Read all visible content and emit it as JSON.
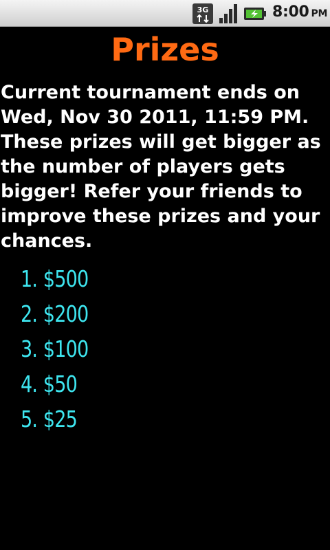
{
  "status_bar": {
    "network_icon": "3g-data-icon",
    "signal_icon": "signal-strength-icon",
    "battery_icon": "battery-charging-icon",
    "time": "8:00",
    "ampm": "PM"
  },
  "page": {
    "title": "Prizes",
    "description": "Current tournament ends on Wed, Nov 30 2011, 11:59 PM. These prizes will get bigger as the number of players gets bigger! Refer your friends to improve these prizes and your chances."
  },
  "prizes": [
    {
      "rank": "1.",
      "amount": "$500"
    },
    {
      "rank": "2.",
      "amount": "$200"
    },
    {
      "rank": "3.",
      "amount": "$100"
    },
    {
      "rank": "4.",
      "amount": "$50"
    },
    {
      "rank": "5.",
      "amount": "$25"
    }
  ],
  "colors": {
    "background": "#000000",
    "title": "#ff6a13",
    "body_text": "#ffffff",
    "prize_text": "#3ee6f0",
    "status_bar": "#e8e8e8"
  }
}
